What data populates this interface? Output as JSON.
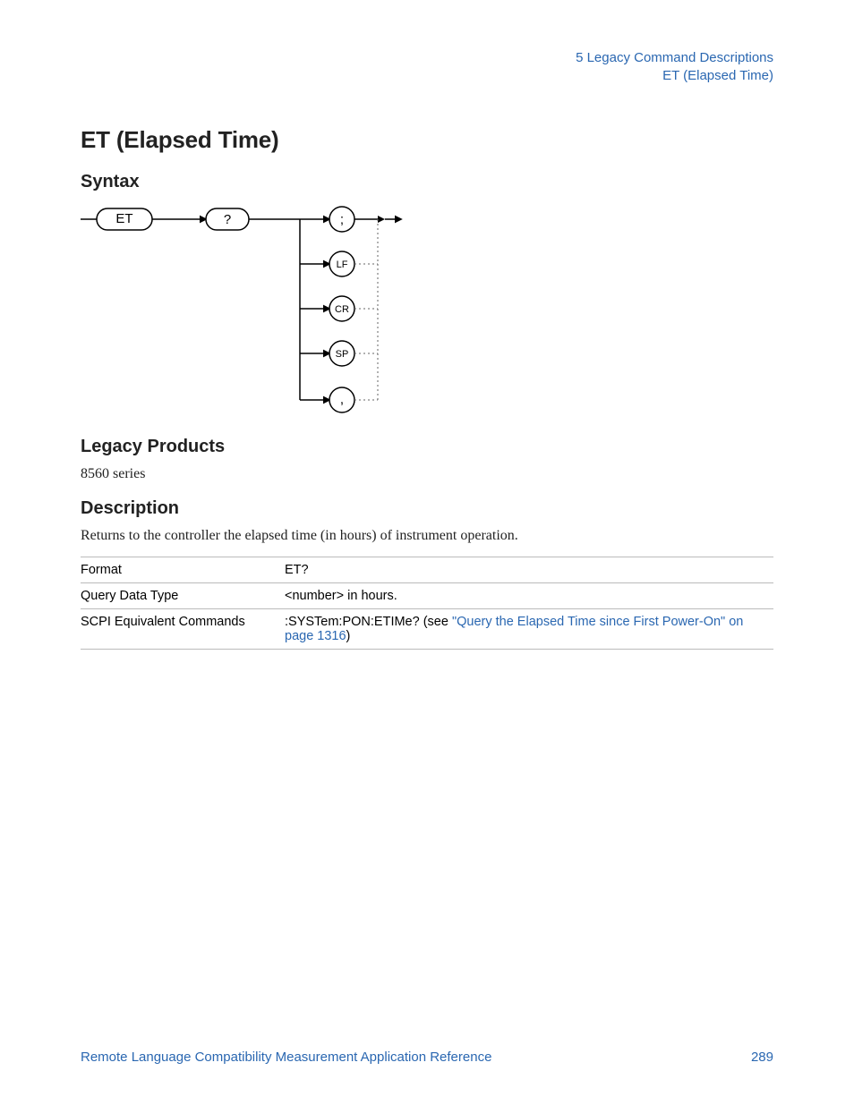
{
  "header": {
    "chapter": "5  Legacy Command Descriptions",
    "topic": "ET (Elapsed Time)"
  },
  "title": "ET (Elapsed Time)",
  "sections": {
    "syntax": "Syntax",
    "legacy_products": "Legacy Products",
    "description": "Description"
  },
  "legacy_products_body": "8560 series",
  "description_body": "Returns to the controller the elapsed time (in hours) of instrument operation.",
  "table": {
    "rows": [
      {
        "label": "Format",
        "value": "ET?"
      },
      {
        "label": "Query Data Type",
        "value": "<number> in hours."
      },
      {
        "label": "SCPI Equivalent Commands",
        "value_prefix": ":SYSTem:PON:ETIMe? (see ",
        "link": "\"Query the Elapsed Time since First Power-On\" on page 1316",
        "value_suffix": ")"
      }
    ]
  },
  "syntax_diagram": {
    "tokens": {
      "cmd": "ET",
      "q": "?"
    },
    "terminators": [
      ";",
      "LF",
      "CR",
      "SP",
      ","
    ]
  },
  "footer": {
    "left": "Remote Language Compatibility Measurement Application Reference",
    "right": "289"
  }
}
